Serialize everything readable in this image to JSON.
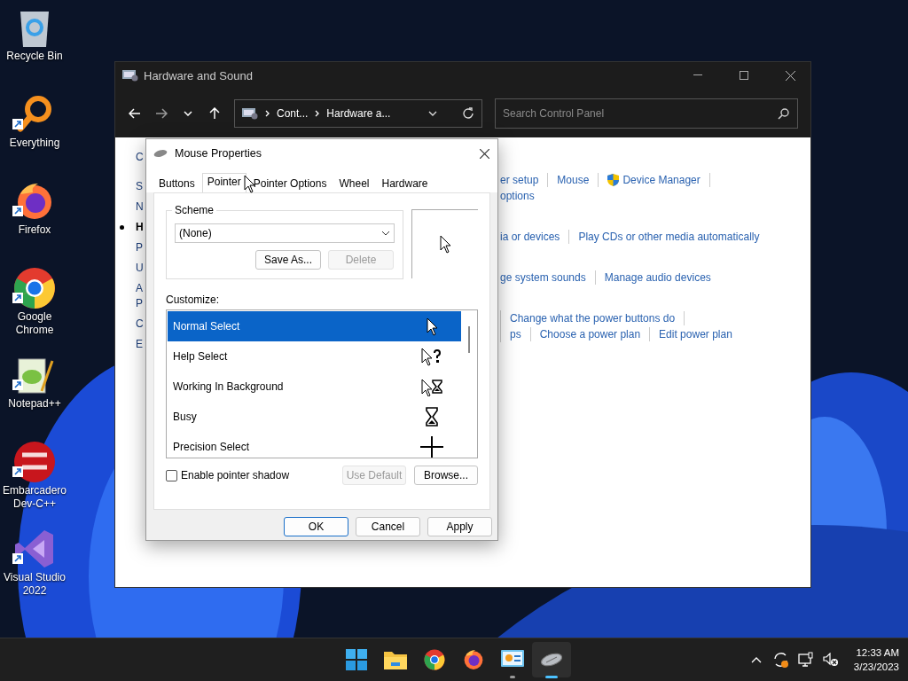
{
  "desktop_icons": [
    {
      "label": "Recycle Bin",
      "kind": "recycle",
      "shortcut": false
    },
    {
      "label": "Everything",
      "kind": "everything",
      "shortcut": true
    },
    {
      "label": "Firefox",
      "kind": "firefox",
      "shortcut": true
    },
    {
      "label": "Google Chrome",
      "kind": "chrome",
      "shortcut": true
    },
    {
      "label": "Notepad++",
      "kind": "notepad",
      "shortcut": true
    },
    {
      "label": "Embarcadero Dev-C++",
      "kind": "devcpp",
      "shortcut": true
    },
    {
      "label": "Visual Studio 2022",
      "kind": "vs",
      "shortcut": true
    }
  ],
  "window": {
    "title": "Hardware and Sound",
    "breadcrumbs": [
      "Cont...",
      "Hardware a..."
    ],
    "search": {
      "placeholder": "Search Control Panel"
    },
    "sidebar": [
      {
        "lines": [
          "C"
        ],
        "selected": false
      },
      {
        "lines": [
          "S"
        ],
        "selected": false
      },
      {
        "lines": [
          "N"
        ],
        "selected": false
      },
      {
        "lines": [
          "H"
        ],
        "selected": true
      },
      {
        "lines": [
          "P"
        ],
        "selected": false
      },
      {
        "lines": [
          "U"
        ],
        "selected": false
      },
      {
        "lines": [
          "A",
          "P"
        ],
        "selected": false
      },
      {
        "lines": [
          "C"
        ],
        "selected": false
      },
      {
        "lines": [
          "E"
        ],
        "selected": false
      }
    ],
    "link_groups": [
      {
        "leading_divider": false,
        "lines": [
          {
            "trailing_divider": true,
            "links": [
              {
                "text": "er setup",
                "kind": "plain"
              },
              {
                "text": "Mouse",
                "kind": "plain"
              },
              {
                "text": "Device Manager",
                "kind": "admin"
              }
            ]
          },
          {
            "trailing_divider": false,
            "links": [
              {
                "text": "options",
                "kind": "plain"
              }
            ]
          }
        ]
      },
      {
        "leading_divider": false,
        "lines": [
          {
            "trailing_divider": false,
            "links": [
              {
                "text": "ia or devices",
                "kind": "plain"
              },
              {
                "text": "Play CDs or other media automatically",
                "kind": "plain"
              }
            ]
          }
        ]
      },
      {
        "leading_divider": false,
        "lines": [
          {
            "trailing_divider": false,
            "links": [
              {
                "text": "ge system sounds",
                "kind": "plain"
              },
              {
                "text": "Manage audio devices",
                "kind": "plain"
              }
            ]
          }
        ]
      },
      {
        "leading_divider": true,
        "lines": [
          {
            "trailing_divider": true,
            "links": [
              {
                "text": "Change what the power buttons do",
                "kind": "plain"
              }
            ]
          },
          {
            "trailing_divider": false,
            "links": [
              {
                "text": "ps",
                "kind": "plain"
              },
              {
                "text": "Choose a power plan",
                "kind": "plain"
              },
              {
                "text": "Edit power plan",
                "kind": "plain"
              }
            ]
          }
        ]
      }
    ]
  },
  "dialog": {
    "title": "Mouse Properties",
    "tabs": [
      {
        "label": "Buttons",
        "selected": false
      },
      {
        "label": "Pointer",
        "selected": true
      },
      {
        "label": "Pointer Options",
        "selected": false
      },
      {
        "label": "Wheel",
        "selected": false
      },
      {
        "label": "Hardware",
        "selected": false
      }
    ],
    "scheme": {
      "label": "Scheme",
      "value": "(None)",
      "buttons": [
        {
          "label": "Save As...",
          "disabled": false
        },
        {
          "label": "Delete",
          "disabled": true
        }
      ]
    },
    "customize_label": "Customize:",
    "pointers": [
      {
        "label": "Normal Select",
        "kind": "arrow",
        "selected": true
      },
      {
        "label": "Help Select",
        "kind": "help",
        "selected": false
      },
      {
        "label": "Working In Background",
        "kind": "working",
        "selected": false
      },
      {
        "label": "Busy",
        "kind": "busy",
        "selected": false
      },
      {
        "label": "Precision Select",
        "kind": "cross",
        "selected": false
      }
    ],
    "shadow": {
      "label": "Enable pointer shadow",
      "checked": false
    },
    "pointer_buttons": [
      {
        "label": "Use Default",
        "disabled": true
      },
      {
        "label": "Browse...",
        "disabled": false
      }
    ],
    "footer_buttons": [
      {
        "label": "OK",
        "default": true
      },
      {
        "label": "Cancel",
        "default": false
      },
      {
        "label": "Apply",
        "default": false
      }
    ]
  },
  "taskbar": {
    "apps": [
      {
        "kind": "start",
        "running": false,
        "active": false
      },
      {
        "kind": "explorer",
        "running": false,
        "active": false
      },
      {
        "kind": "chrome",
        "running": false,
        "active": false
      },
      {
        "kind": "firefox",
        "running": false,
        "active": false
      },
      {
        "kind": "controlpanel",
        "running": true,
        "active": false
      },
      {
        "kind": "mouse",
        "running": true,
        "active": true
      }
    ],
    "time": "12:33 AM",
    "date": "3/23/2023"
  }
}
